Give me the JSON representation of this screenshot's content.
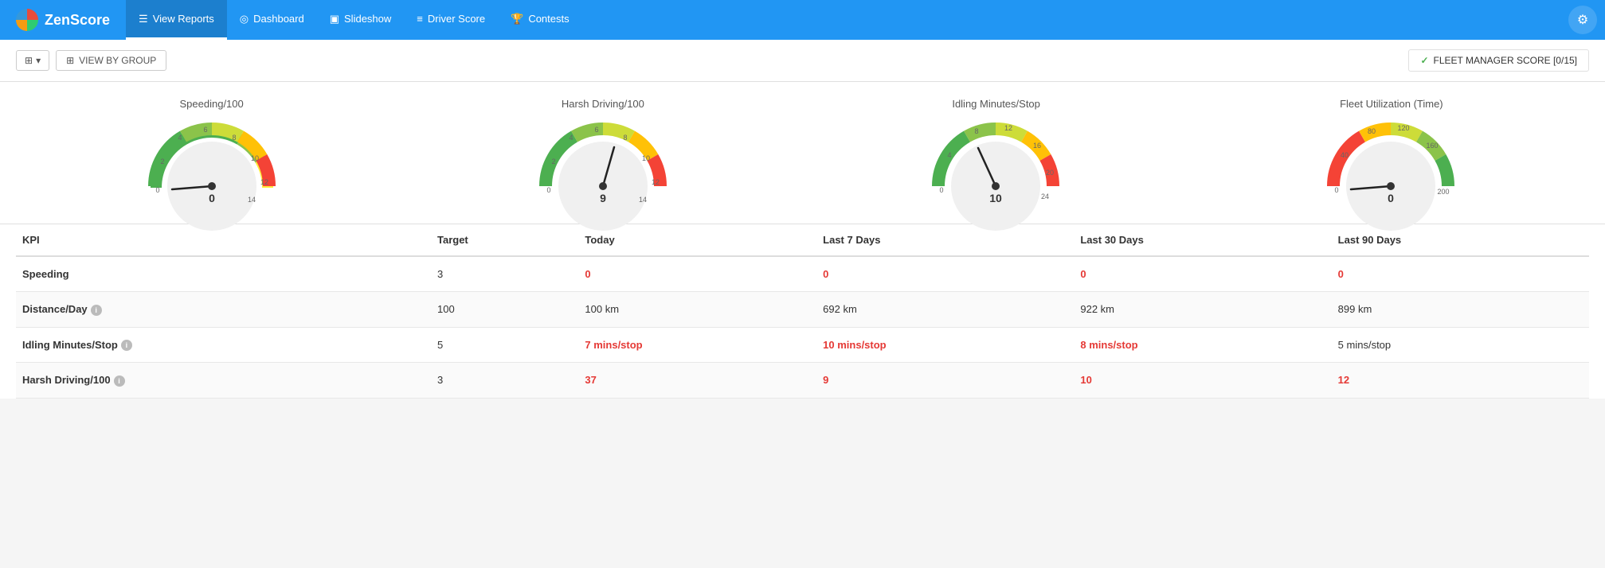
{
  "app": {
    "brand": "ZenScore",
    "gear_icon": "⚙"
  },
  "nav": {
    "items": [
      {
        "id": "view-reports",
        "label": "View Reports",
        "icon": "☰",
        "active": true
      },
      {
        "id": "dashboard",
        "label": "Dashboard",
        "icon": "◎"
      },
      {
        "id": "slideshow",
        "label": "Slideshow",
        "icon": "▣"
      },
      {
        "id": "driver-score",
        "label": "Driver Score",
        "icon": "≡"
      },
      {
        "id": "contests",
        "label": "Contests",
        "icon": "🏆"
      }
    ]
  },
  "toolbar": {
    "view_group_label": "VIEW BY GROUP",
    "fleet_score_label": "FLEET MANAGER SCORE [0/15]"
  },
  "gauges": [
    {
      "id": "speeding",
      "title": "Speeding/100",
      "value": 0,
      "min": 0,
      "max": 16,
      "scale_labels": [
        "0",
        "2",
        "4",
        "6",
        "8",
        "10",
        "12",
        "14"
      ],
      "type": "speeding"
    },
    {
      "id": "harsh-driving",
      "title": "Harsh Driving/100",
      "value": 9,
      "min": 0,
      "max": 16,
      "scale_labels": [
        "0",
        "2",
        "4",
        "6",
        "8",
        "10",
        "12",
        "14"
      ],
      "type": "harsh"
    },
    {
      "id": "idling",
      "title": "Idling Minutes/Stop",
      "value": 10,
      "min": 0,
      "max": 28,
      "scale_labels": [
        "0",
        "4",
        "8",
        "12",
        "16",
        "20",
        "24"
      ],
      "type": "idling"
    },
    {
      "id": "fleet-util",
      "title": "Fleet Utilization (Time)",
      "value": 0,
      "min": 0,
      "max": 200,
      "scale_labels": [
        "0",
        "40",
        "80",
        "120",
        "160",
        "200"
      ],
      "type": "fleet"
    }
  ],
  "table": {
    "headers": [
      "KPI",
      "Target",
      "Today",
      "Last 7 Days",
      "Last 30 Days",
      "Last 90 Days"
    ],
    "rows": [
      {
        "kpi": "Speeding",
        "has_info": false,
        "target": "3",
        "today": {
          "value": "0",
          "red": true
        },
        "last7": {
          "value": "0",
          "red": true
        },
        "last30": {
          "value": "0",
          "red": true
        },
        "last90": {
          "value": "0",
          "red": true
        }
      },
      {
        "kpi": "Distance/Day",
        "has_info": true,
        "target": "100",
        "today": {
          "value": "100 km",
          "red": false
        },
        "last7": {
          "value": "692 km",
          "red": false
        },
        "last30": {
          "value": "922 km",
          "red": false
        },
        "last90": {
          "value": "899 km",
          "red": false
        }
      },
      {
        "kpi": "Idling Minutes/Stop",
        "has_info": true,
        "target": "5",
        "today": {
          "value": "7 mins/stop",
          "red": true
        },
        "last7": {
          "value": "10 mins/stop",
          "red": true
        },
        "last30": {
          "value": "8 mins/stop",
          "red": true
        },
        "last90": {
          "value": "5 mins/stop",
          "red": false
        }
      },
      {
        "kpi": "Harsh Driving/100",
        "has_info": true,
        "target": "3",
        "today": {
          "value": "37",
          "red": true
        },
        "last7": {
          "value": "9",
          "red": true
        },
        "last30": {
          "value": "10",
          "red": true
        },
        "last90": {
          "value": "12",
          "red": true
        }
      }
    ]
  }
}
